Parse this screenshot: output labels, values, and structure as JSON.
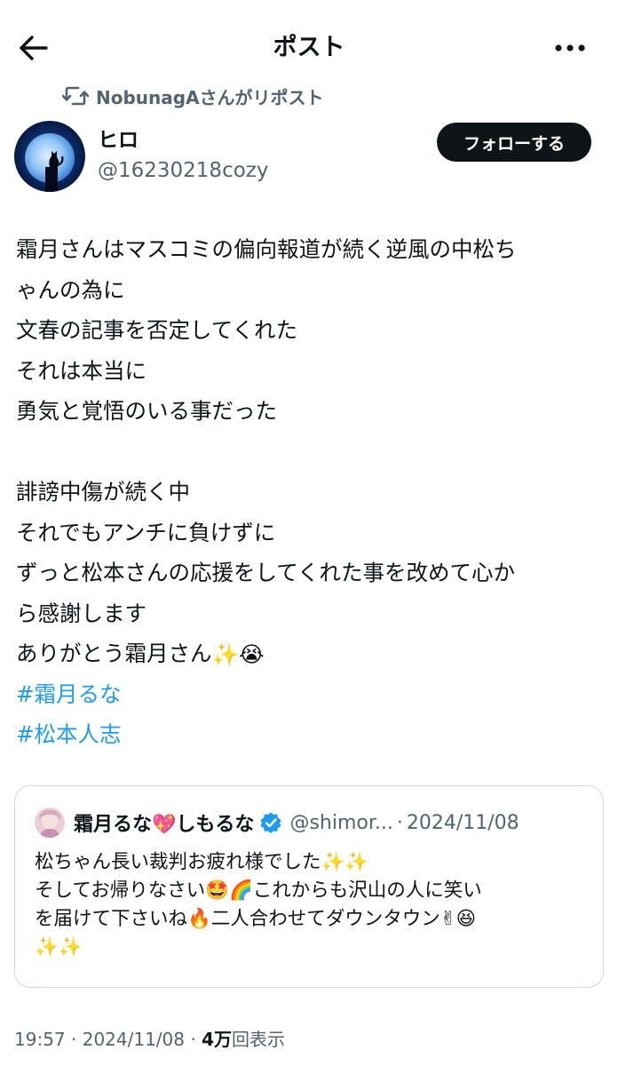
{
  "header": {
    "title": "ポスト"
  },
  "repost": {
    "text": "NobunagAさんがリポスト"
  },
  "author": {
    "display_name": "ヒロ",
    "handle": "@16230218cozy",
    "follow_label": "フォローする"
  },
  "tweet": {
    "lines": [
      "霜月さんはマスコミの偏向報道が続く逆風の中松ち",
      "ゃんの為に",
      "文春の記事を否定してくれた",
      "それは本当に",
      "勇気と覚悟のいる事だった",
      "",
      "誹謗中傷が続く中",
      "それでもアンチに負けずに",
      "ずっと松本さんの応援をしてくれた事を改めて心か",
      "ら感謝します",
      "ありがとう霜月さん"
    ],
    "last_line_emojis": "✨😭",
    "hashtags": [
      "#霜月るな",
      "#松本人志"
    ]
  },
  "quote": {
    "name_part1": "霜月るな",
    "name_emoji": "💖",
    "name_part2": "しもるな",
    "handle": "@shimor...",
    "dot": "·",
    "date": "2024/11/08",
    "line1": "松ちゃん長い裁判お疲れ様でした✨✨",
    "line2": "そしてお帰りなさい🤩🌈これからも沢山の人に笑い",
    "line3": "を届けて下さいね🔥二人合わせてダウンタウン✌😆",
    "line4": "✨✨"
  },
  "meta": {
    "time": "19:57",
    "sep1": "·",
    "date": "2024/11/08",
    "sep2": "·",
    "views_count": "4万",
    "views_label": "回表示"
  },
  "colors": {
    "text": "#0f1419",
    "secondary": "#536471",
    "link": "#1d9bf0",
    "verified": "#1d9bf0",
    "follow_bg": "#0f1419",
    "border": "#cfd9de"
  },
  "icons": {
    "back": "arrow-left-icon",
    "more": "more-horizontal-icon",
    "repost": "repost-icon",
    "verified": "verified-badge-icon"
  }
}
